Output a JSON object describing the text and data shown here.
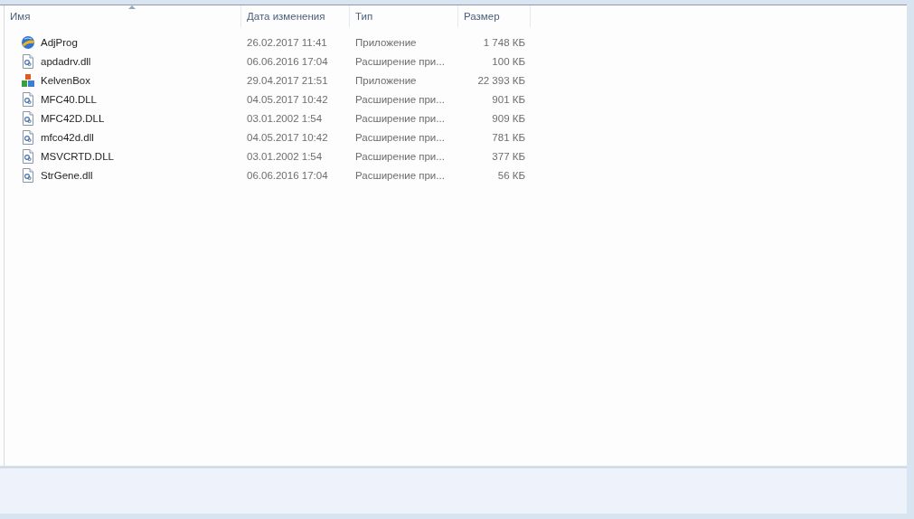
{
  "table": {
    "columns": [
      {
        "label": "Имя",
        "sorted": true
      },
      {
        "label": "Дата изменения",
        "sorted": false
      },
      {
        "label": "Тип",
        "sorted": false
      },
      {
        "label": "Размер",
        "sorted": false
      }
    ],
    "rows": [
      {
        "kind": "app-globe",
        "name": "AdjProg",
        "date": "26.02.2017 11:41",
        "type": "Приложение",
        "size": "1 748 КБ"
      },
      {
        "kind": "dll",
        "name": "apdadrv.dll",
        "date": "06.06.2016 17:04",
        "type": "Расширение при...",
        "size": "100 КБ"
      },
      {
        "kind": "app-blocks",
        "name": "KelvenBox",
        "date": "29.04.2017 21:51",
        "type": "Приложение",
        "size": "22 393 КБ"
      },
      {
        "kind": "dll",
        "name": "MFC40.DLL",
        "date": "04.05.2017 10:42",
        "type": "Расширение при...",
        "size": "901 КБ"
      },
      {
        "kind": "dll",
        "name": "MFC42D.DLL",
        "date": "03.01.2002 1:54",
        "type": "Расширение при...",
        "size": "909 КБ"
      },
      {
        "kind": "dll",
        "name": "mfco42d.dll",
        "date": "04.05.2017 10:42",
        "type": "Расширение при...",
        "size": "781 КБ"
      },
      {
        "kind": "dll",
        "name": "MSVCRTD.DLL",
        "date": "03.01.2002 1:54",
        "type": "Расширение при...",
        "size": "377 КБ"
      },
      {
        "kind": "dll",
        "name": "StrGene.dll",
        "date": "06.06.2016 17:04",
        "type": "Расширение при...",
        "size": "56 КБ"
      }
    ]
  }
}
